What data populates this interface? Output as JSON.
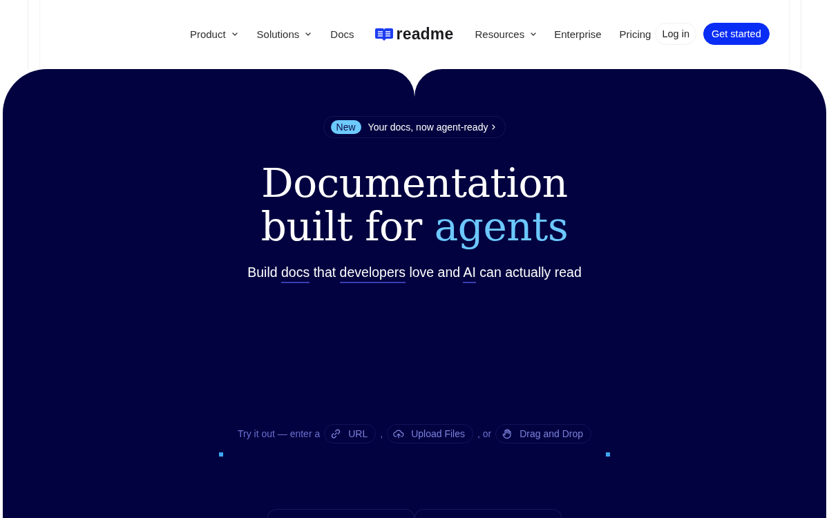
{
  "nav": {
    "left_items": [
      {
        "label": "Product",
        "dropdown": true
      },
      {
        "label": "Solutions",
        "dropdown": true
      },
      {
        "label": "Docs",
        "dropdown": false
      }
    ],
    "logo": {
      "text": "readme"
    },
    "right_items": [
      {
        "label": "Resources",
        "dropdown": true
      },
      {
        "label": "Enterprise",
        "dropdown": false
      },
      {
        "label": "Pricing",
        "dropdown": false
      }
    ],
    "buttons": [
      {
        "label": "Log in",
        "kind": "secondary"
      },
      {
        "label": "Get started",
        "kind": "primary"
      }
    ]
  },
  "hero": {
    "announcement": {
      "badge": "New",
      "text": "Your docs, now agent-ready"
    },
    "heading": {
      "text": "Documentation built for",
      "highlight": "agents"
    },
    "subtitle": [
      {
        "text": "Build ",
        "underlined": false
      },
      {
        "text": "docs",
        "underlined": true
      },
      {
        "text": " that ",
        "underlined": false
      },
      {
        "text": "developers",
        "underlined": true
      },
      {
        "text": " love and ",
        "underlined": false
      },
      {
        "text": "AI",
        "underlined": true
      },
      {
        "text": " can actually read",
        "underlined": false
      }
    ],
    "try_it": [
      {
        "kind": "text",
        "text": "Try it out — enter a"
      },
      {
        "kind": "url",
        "text": "URL"
      },
      {
        "kind": "text",
        "text": ","
      },
      {
        "kind": "upload",
        "text": "Upload Files"
      },
      {
        "kind": "text",
        "text": ", or"
      },
      {
        "kind": "drag",
        "text": "Drag and Drop"
      }
    ]
  }
}
